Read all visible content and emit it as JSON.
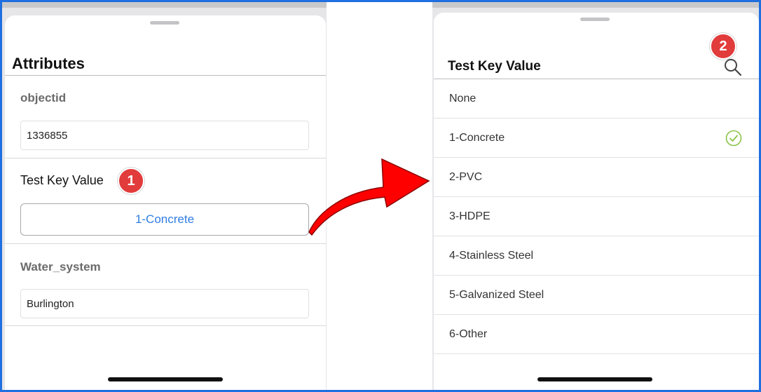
{
  "attributes_panel": {
    "title": "Attributes",
    "fields": [
      {
        "label": "objectid",
        "value": "1336855"
      },
      {
        "label": "Test Key Value",
        "value": "1-Concrete"
      },
      {
        "label": "Water_system",
        "value": "Burlington"
      }
    ],
    "badge": "1"
  },
  "picker_panel": {
    "title": "Test Key Value",
    "badge": "2",
    "search_icon": "search-icon",
    "options": [
      {
        "label": "None",
        "selected": false
      },
      {
        "label": "1-Concrete",
        "selected": true
      },
      {
        "label": "2-PVC",
        "selected": false
      },
      {
        "label": "3-HDPE",
        "selected": false
      },
      {
        "label": "4-Stainless Steel",
        "selected": false
      },
      {
        "label": "5-Galvanized Steel",
        "selected": false
      },
      {
        "label": "6-Other",
        "selected": false
      }
    ]
  },
  "colors": {
    "accent": "#2f7de1",
    "badge": "#e23b3b",
    "arrow": "#ff0000",
    "check": "#8bc34a",
    "frame": "#1f6fe0"
  }
}
